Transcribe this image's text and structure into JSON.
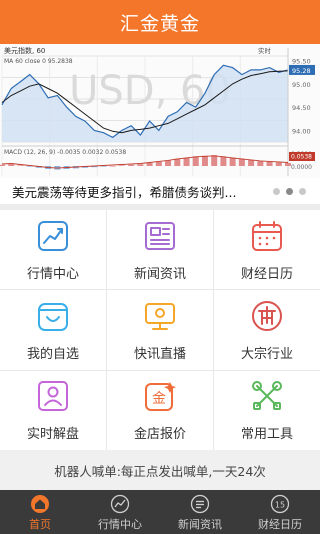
{
  "app": {
    "title": "汇金黄金"
  },
  "banner": {
    "caption": "美元震荡等待更多指引，希腊债务谈判...",
    "active_index": 1,
    "slide_count": 3,
    "chart": {
      "title": "美元指数, 60",
      "watermark": "USD, 60",
      "ma_label": "MA 60 close 0 95.2838",
      "top_right_label": "实时",
      "price_ticks": [
        "95.50",
        "95.00",
        "94.50",
        "94.00"
      ],
      "price_current": "95.28",
      "macd_label": "MACD (12, 26, 9)  -0.0035  0.0032  0.0538",
      "macd_ticks": [
        "0.2000",
        "0.0000"
      ],
      "macd_current": "0.0538",
      "price_path": [
        94.55,
        94.9,
        95.05,
        95.2,
        95.0,
        94.7,
        94.75,
        94.5,
        94.3,
        94.2,
        94.0,
        93.95,
        93.85,
        94.0,
        94.1,
        93.9,
        94.2,
        94.0,
        94.3,
        94.4,
        94.6,
        94.5,
        94.8,
        95.2,
        95.4,
        95.35,
        95.2,
        95.3,
        95.3,
        95.35,
        95.25,
        95.3
      ],
      "ma_path": [
        94.6,
        94.75,
        94.85,
        94.95,
        95.0,
        94.9,
        94.8,
        94.65,
        94.5,
        94.35,
        94.2,
        94.05,
        93.98,
        93.95,
        94.0,
        94.02,
        94.05,
        94.1,
        94.15,
        94.25,
        94.35,
        94.45,
        94.55,
        94.7,
        94.85,
        95.0,
        95.1,
        95.18,
        95.22,
        95.26,
        95.27,
        95.28
      ],
      "macd_hist": [
        0.02,
        0.03,
        0.01,
        -0.01,
        -0.03,
        -0.05,
        -0.06,
        -0.05,
        -0.04,
        -0.03,
        -0.02,
        -0.01,
        0.0,
        0.01,
        0.02,
        0.03,
        0.05,
        0.07,
        0.09,
        0.12,
        0.14,
        0.16,
        0.17,
        0.18,
        0.16,
        0.14,
        0.12,
        0.1,
        0.08,
        0.07,
        0.06,
        0.05
      ],
      "ymin": 93.75,
      "ymax": 95.6
    }
  },
  "menu": [
    {
      "name": "market-center",
      "label": "行情中心",
      "icon": "trend-chart-icon",
      "color": "#3a8fd9"
    },
    {
      "name": "news",
      "label": "新闻资讯",
      "icon": "newspaper-icon",
      "color": "#a66bd2"
    },
    {
      "name": "calendar",
      "label": "财经日历",
      "icon": "calendar-icon",
      "color": "#e85a4f"
    },
    {
      "name": "watchlist",
      "label": "我的自选",
      "icon": "bag-smile-icon",
      "color": "#3aaee8"
    },
    {
      "name": "live",
      "label": "快讯直播",
      "icon": "monitor-icon",
      "color": "#f4a629"
    },
    {
      "name": "commodities",
      "label": "大宗行业",
      "icon": "building-seal-icon",
      "color": "#d9534f"
    },
    {
      "name": "analysis",
      "label": "实时解盘",
      "icon": "user-screen-icon",
      "color": "#c466d9"
    },
    {
      "name": "gold-quote",
      "label": "金店报价",
      "icon": "gold-badge-icon",
      "color": "#f06c38"
    },
    {
      "name": "tools",
      "label": "常用工具",
      "icon": "tools-icon",
      "color": "#5cb85c"
    }
  ],
  "robot_bar": {
    "text": "机器人喊单:每正点发出喊单,一天24次"
  },
  "tabs": [
    {
      "name": "home",
      "label": "首页",
      "icon": "home-icon",
      "active": true
    },
    {
      "name": "market",
      "label": "行情中心",
      "icon": "chart-circle-icon",
      "active": false
    },
    {
      "name": "news",
      "label": "新闻资讯",
      "icon": "news-circle-icon",
      "active": false
    },
    {
      "name": "calendar",
      "label": "财经日历",
      "icon": "calendar-15-icon",
      "active": false,
      "badge": "15"
    }
  ],
  "colors": {
    "accent": "#f4762b",
    "tabbar": "#3a3a3a"
  }
}
